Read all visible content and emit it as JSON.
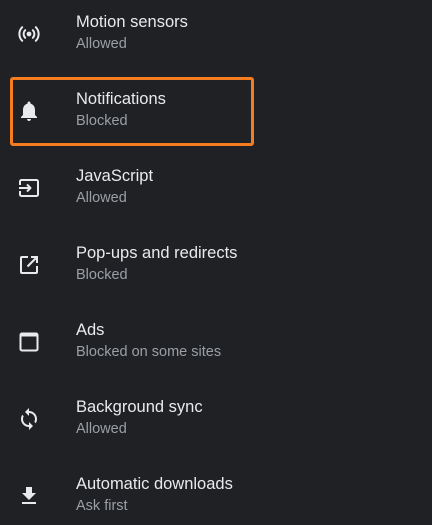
{
  "settings": {
    "items": [
      {
        "title": "Motion sensors",
        "status": "Allowed",
        "icon": "motion-sensor-icon"
      },
      {
        "title": "Notifications",
        "status": "Blocked",
        "icon": "bell-icon"
      },
      {
        "title": "JavaScript",
        "status": "Allowed",
        "icon": "javascript-icon"
      },
      {
        "title": "Pop-ups and redirects",
        "status": "Blocked",
        "icon": "external-link-icon"
      },
      {
        "title": "Ads",
        "status": "Blocked on some sites",
        "icon": "ads-window-icon"
      },
      {
        "title": "Background sync",
        "status": "Allowed",
        "icon": "sync-icon"
      },
      {
        "title": "Automatic downloads",
        "status": "Ask first",
        "icon": "download-icon"
      }
    ]
  },
  "highlight": {
    "color": "#f57c1f",
    "target": "Notifications"
  }
}
